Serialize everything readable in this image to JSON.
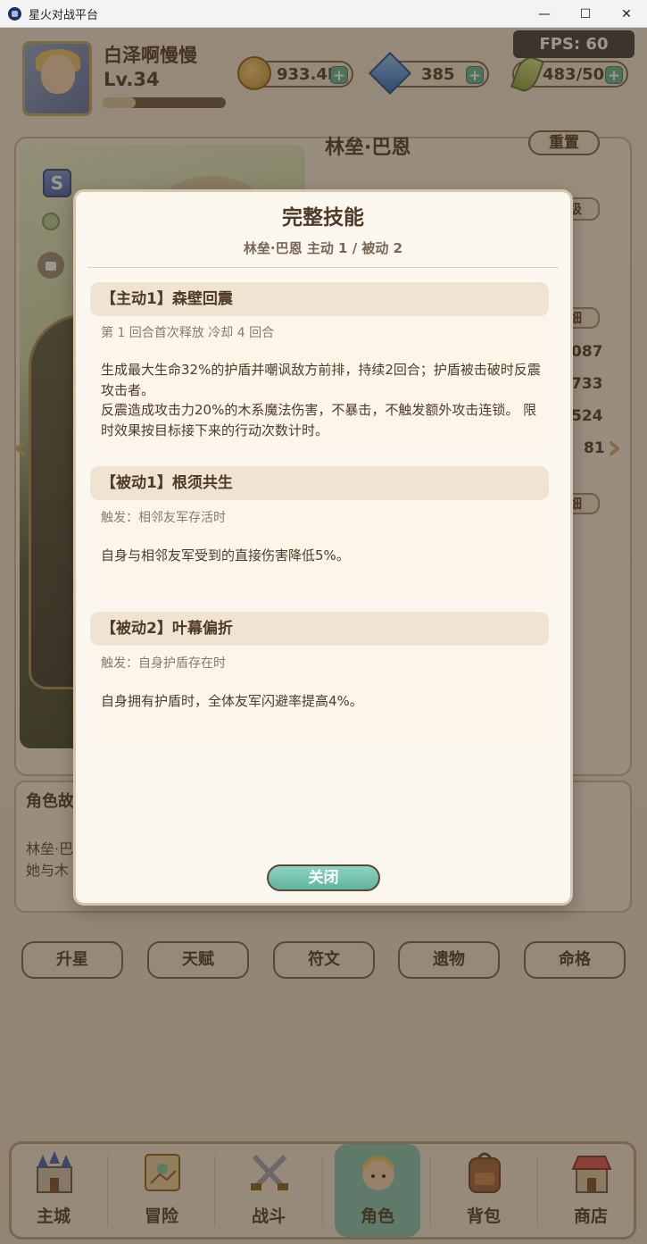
{
  "window": {
    "title": "星火对战平台",
    "minimize": "—",
    "maximize": "☐",
    "close": "✕"
  },
  "fps": "FPS: 60",
  "player": {
    "name": "白泽啊慢慢",
    "level": "Lv.34",
    "xp_fraction": 0.27
  },
  "resources": {
    "gold": "933.4K",
    "gems": "385",
    "stamina": "483/500",
    "plus": "+"
  },
  "hero": {
    "name": "林垒·巴恩",
    "rarity": "S",
    "reset_label": "重置",
    "upgrade_label": "升级",
    "detail_label": "详细",
    "stats": [
      "087",
      "733",
      "524",
      "81"
    ]
  },
  "story": {
    "title": "角色故",
    "line1": "林垒·巴",
    "line2": "她与木"
  },
  "actions": [
    "升星",
    "天赋",
    "符文",
    "遗物",
    "命格"
  ],
  "nav": [
    "主城",
    "冒险",
    "战斗",
    "角色",
    "背包",
    "商店"
  ],
  "modal": {
    "title": "完整技能",
    "subtitle": "林垒·巴恩    主动 1 / 被动 2",
    "skills": [
      {
        "name": "【主动1】森壁回震",
        "meta": "第 1 回合首次释放    冷却 4 回合",
        "desc": "生成最大生命32%的护盾并嘲讽敌方前排，持续2回合；护盾被击破时反震攻击者。\n反震造成攻击力20%的木系魔法伤害，不暴击，不触发额外攻击连锁。 限时效果按目标接下来的行动次数计时。"
      },
      {
        "name": "【被动1】根须共生",
        "meta": "触发：相邻友军存活时",
        "desc": "自身与相邻友军受到的直接伤害降低5%。"
      },
      {
        "name": "【被动2】叶幕偏折",
        "meta": "触发：自身护盾存在时",
        "desc": "自身拥有护盾时，全体友军闪避率提高4%。"
      }
    ],
    "close_label": "关闭"
  }
}
